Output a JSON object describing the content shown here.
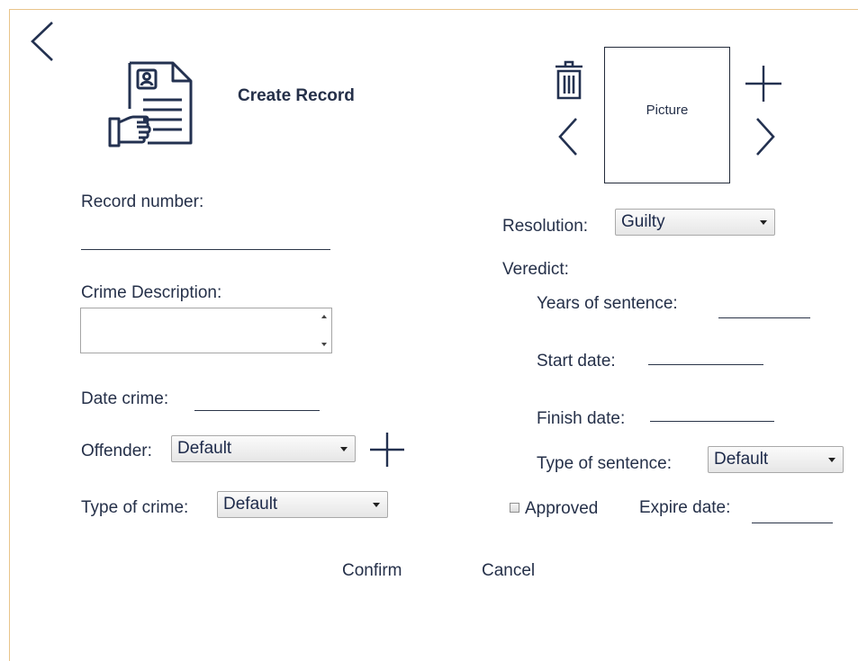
{
  "header": {
    "title": "Create Record"
  },
  "left": {
    "record_number_label": "Record number:",
    "crime_description_label": "Crime Description:",
    "date_crime_label": "Date crime:",
    "offender_label": "Offender:",
    "offender_value": "Default",
    "type_of_crime_label": "Type of crime:",
    "type_of_crime_value": "Default"
  },
  "picture": {
    "label": "Picture"
  },
  "right": {
    "resolution_label": "Resolution:",
    "resolution_value": "Guilty",
    "veredict_label": "Veredict:",
    "years_label": "Years of sentence:",
    "start_date_label": "Start date:",
    "finish_date_label": "Finish date:",
    "type_of_sentence_label": "Type of sentence:",
    "type_of_sentence_value": "Default",
    "approved_label": "Approved",
    "expire_date_label": "Expire date:"
  },
  "actions": {
    "confirm_label": "Confirm",
    "cancel_label": "Cancel"
  },
  "icons": {
    "back": "chevron-left-icon",
    "record": "document-in-hand-icon",
    "trash": "trash-icon",
    "add_picture": "plus-icon",
    "prev_picture": "chevron-left-icon",
    "next_picture": "chevron-right-icon",
    "add_offender": "plus-icon"
  },
  "colors": {
    "icon": "#233150",
    "frame_border": "#e9c48a"
  }
}
